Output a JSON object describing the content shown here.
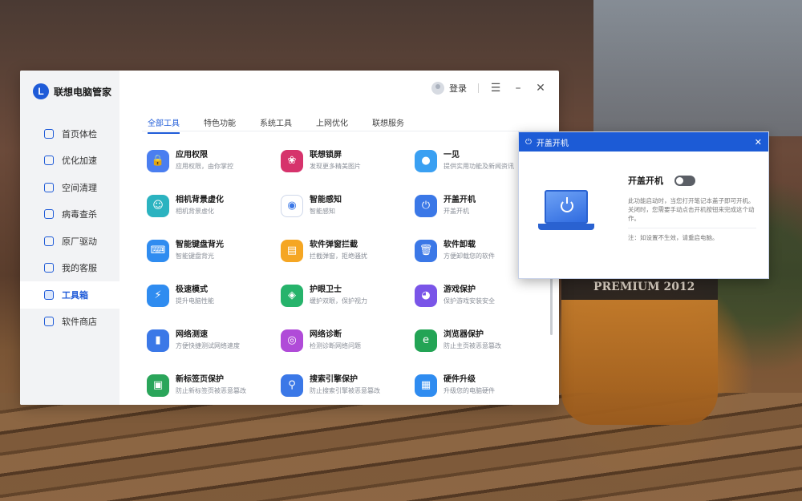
{
  "app": {
    "name": "联想电脑管家",
    "logo_letter": "L",
    "login_label": "登录"
  },
  "sidebar": {
    "items": [
      {
        "label": "首页体检",
        "icon": "monitor-icon"
      },
      {
        "label": "优化加速",
        "icon": "rocket-icon"
      },
      {
        "label": "空间清理",
        "icon": "broom-icon"
      },
      {
        "label": "病毒查杀",
        "icon": "shield-icon"
      },
      {
        "label": "原厂驱动",
        "icon": "driver-icon"
      },
      {
        "label": "我的客服",
        "icon": "headset-icon"
      },
      {
        "label": "工具箱",
        "icon": "toolbox-icon",
        "active": true
      },
      {
        "label": "软件商店",
        "icon": "store-icon"
      }
    ]
  },
  "tabs": [
    {
      "label": "全部工具",
      "active": true
    },
    {
      "label": "特色功能"
    },
    {
      "label": "系统工具"
    },
    {
      "label": "上网优化"
    },
    {
      "label": "联想服务"
    }
  ],
  "tools": [
    {
      "name": "应用权限",
      "desc": "应用权限，由你掌控",
      "color": "#4a7ef0",
      "glyph": "🔒"
    },
    {
      "name": "联想锁屏",
      "desc": "发现更多精美图片",
      "color": "#d6336c",
      "glyph": "❀"
    },
    {
      "name": "一见",
      "desc": "提供实用功能及新闻资讯",
      "color": "#3aa0f2",
      "glyph": "●"
    },
    {
      "name": "相机背景虚化",
      "desc": "相机背景虚化",
      "color": "#2bb3c0",
      "glyph": "☺"
    },
    {
      "name": "智能感知",
      "desc": "智能感知",
      "color": "#ffffff",
      "glyph": "◉"
    },
    {
      "name": "开盖开机",
      "desc": "开盖开机",
      "color": "#3b78e7",
      "glyph": "⏻"
    },
    {
      "name": "智能键盘背光",
      "desc": "智能键盘背光",
      "color": "#2f8cf0",
      "glyph": "⌨"
    },
    {
      "name": "软件弹窗拦截",
      "desc": "拦截弹窗，拒绝骚扰",
      "color": "#f5a623",
      "glyph": "▤"
    },
    {
      "name": "软件卸载",
      "desc": "方便卸载您的软件",
      "color": "#3b78e7",
      "glyph": "🗑"
    },
    {
      "name": "极速模式",
      "desc": "提升电脑性能",
      "color": "#2f8cf0",
      "glyph": "⚡"
    },
    {
      "name": "护眼卫士",
      "desc": "缓护双眼，保护视力",
      "color": "#26b36b",
      "glyph": "◈"
    },
    {
      "name": "游戏保护",
      "desc": "保护游戏安装安全",
      "color": "#7a55e8",
      "glyph": "◕"
    },
    {
      "name": "网络测速",
      "desc": "方便快捷测试网络速度",
      "color": "#3b78e7",
      "glyph": "▮"
    },
    {
      "name": "网络诊断",
      "desc": "检测诊断网络问题",
      "color": "#b04bd8",
      "glyph": "◎"
    },
    {
      "name": "浏览器保护",
      "desc": "防止主页被恶意篡改",
      "color": "#23a455",
      "glyph": "e"
    },
    {
      "name": "新标签页保护",
      "desc": "防止新标签页被恶意篡改",
      "color": "#2aa55a",
      "glyph": "▣"
    },
    {
      "name": "搜索引擎保护",
      "desc": "防止搜索引擎被恶意篡改",
      "color": "#3b78e7",
      "glyph": "⚲"
    },
    {
      "name": "硬件升级",
      "desc": "升级您的电脑硬件",
      "color": "#2f8cf0",
      "glyph": "▦"
    }
  ],
  "popup": {
    "header_title": "开盖开机",
    "title": "开盖开机",
    "toggle_on": false,
    "desc": "此功能启动时，当您打开笔记本盖子即可开机。关闭时，您需要手动点击开机按钮来完成这个动作。",
    "note": "注：如设置不生效，请重启电脑。"
  },
  "background": {
    "glass_text": "PREMIUM 2012"
  }
}
